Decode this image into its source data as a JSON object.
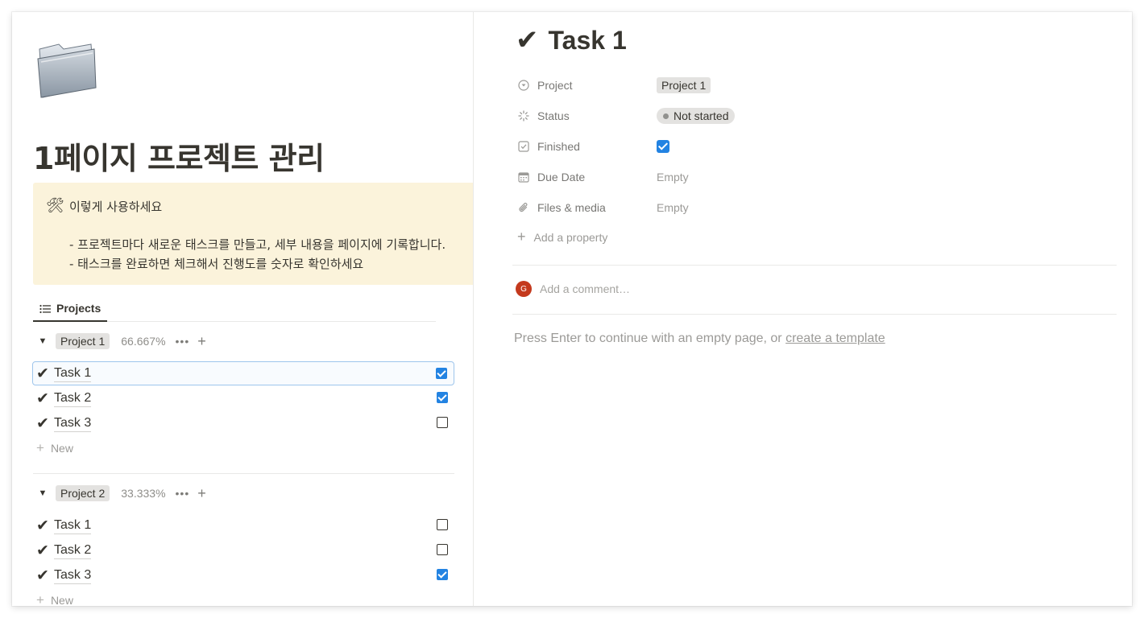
{
  "left": {
    "page_title": "1페이지 프로젝트 관리",
    "page_icon": "folder-icon",
    "callout": {
      "icon": "hammer-and-wrench-icon",
      "icon_glyph": "🛠",
      "heading": "이렇게 사용하세요",
      "lines": [
        "- 프로젝트마다 새로운 태스크를 만들고, 세부 내용을 페이지에 기록합니다.",
        "- 태스크를 완료하면 체크해서 진행도를 숫자로 확인하세요"
      ]
    },
    "view_tab": {
      "label": "Projects",
      "icon": "list-icon"
    },
    "groups": [
      {
        "toggle": "▼",
        "name": "Project 1",
        "percent": "66.667%",
        "more": "•••",
        "add": "+",
        "tasks": [
          {
            "check": "✔",
            "name": "Task 1",
            "done": true,
            "selected": true
          },
          {
            "check": "✔",
            "name": "Task 2",
            "done": true
          },
          {
            "check": "✔",
            "name": "Task 3",
            "done": false
          }
        ],
        "new_label": "New"
      },
      {
        "toggle": "▼",
        "name": "Project 2",
        "percent": "33.333%",
        "more": "•••",
        "add": "+",
        "tasks": [
          {
            "check": "✔",
            "name": "Task 1",
            "done": false
          },
          {
            "check": "✔",
            "name": "Task 2",
            "done": false
          },
          {
            "check": "✔",
            "name": "Task 3",
            "done": true
          }
        ],
        "new_label": "New"
      }
    ]
  },
  "right": {
    "title_check": "✔",
    "title": "Task 1",
    "properties": [
      {
        "icon": "relation-icon",
        "label": "Project",
        "value": "Project 1"
      },
      {
        "icon": "status-icon",
        "label": "Status",
        "value": "Not started"
      },
      {
        "icon": "checkbox-icon",
        "label": "Finished",
        "value": true
      },
      {
        "icon": "calendar-icon",
        "label": "Due Date",
        "value": "Empty"
      },
      {
        "icon": "paperclip-icon",
        "label": "Files & media",
        "value": "Empty"
      }
    ],
    "add_property": "Add a property",
    "comment": {
      "avatar_initial": "G",
      "placeholder": "Add a comment…"
    },
    "empty_hint_prefix": "Press Enter to continue with an empty page, or ",
    "empty_hint_link": "create a template"
  },
  "colors": {
    "callout_bg": "#fbf3db",
    "accent_blue": "#2383e2",
    "tag_gray": "#e3e2e0",
    "avatar_red": "#c4391d"
  }
}
